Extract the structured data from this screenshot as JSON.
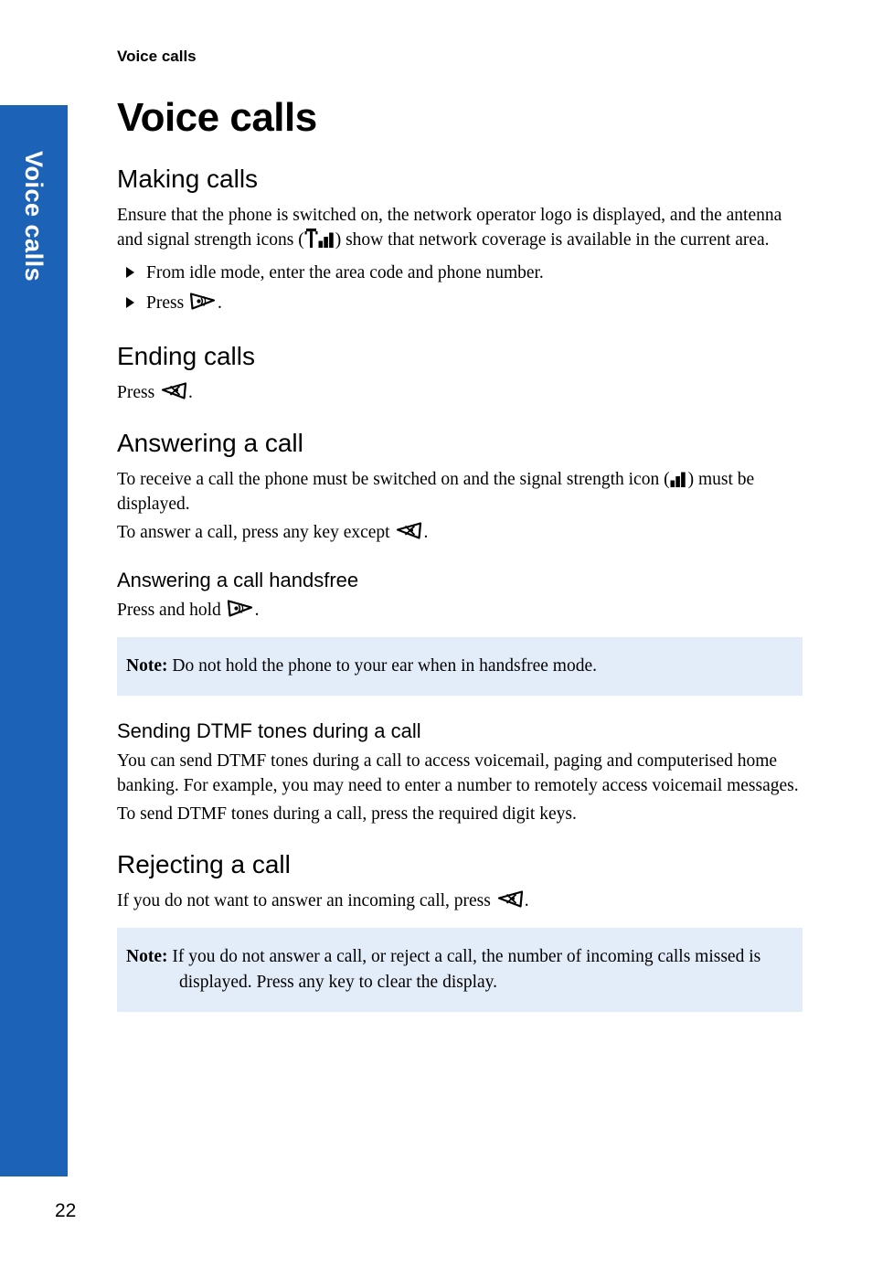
{
  "page": {
    "running_head": "Voice calls",
    "page_number": "22",
    "side_tab_label": "Voice calls",
    "accent_color": "#1c63b8",
    "note_background": "#e3edfa"
  },
  "chapter": {
    "title": "Voice calls"
  },
  "sections": {
    "making_calls": {
      "heading": "Making calls",
      "intro_part1": "Ensure that the phone is switched on, the network operator logo is displayed, and the antenna and signal strength icons (",
      "intro_part2": ") show that network coverage is available in the current area.",
      "steps": [
        {
          "text_before": "From idle mode, enter the area code and phone number.",
          "icon": null,
          "text_after": ""
        },
        {
          "text_before": "Press ",
          "icon": "send-key-icon",
          "text_after": "."
        }
      ]
    },
    "ending_calls": {
      "heading": "Ending calls",
      "text_before": "Press ",
      "icon": "end-key-icon",
      "text_after": "."
    },
    "answering_a_call": {
      "heading": "Answering a call",
      "para1_part1": "To receive a call the phone must be switched on and the signal strength icon (",
      "para1_part2": ") must be displayed.",
      "para2_part1": "To answer a call, press any key except ",
      "para2_part2": ".",
      "handsfree": {
        "heading": "Answering a call handsfree",
        "text_before": "Press and hold ",
        "text_after": "."
      },
      "note": {
        "label": "Note:",
        "text": " Do not hold the phone to your ear when in handsfree mode."
      }
    },
    "sending_dtmf": {
      "heading": "Sending DTMF tones during a call",
      "para1": "You can send DTMF tones during a call to access voicemail, paging and computerised home banking. For example, you may need to enter a number to remotely access voicemail messages.",
      "para2": "To send DTMF tones during a call, press the required digit keys."
    },
    "rejecting_a_call": {
      "heading": "Rejecting a call",
      "para1_part1": "If you do not want to answer an incoming call, press ",
      "para1_part2": ".",
      "note": {
        "label": "Note:",
        "text": " If you do not answer a call, or reject a call, the number of incoming calls missed is displayed. Press any key to clear the display."
      }
    }
  },
  "icons": {
    "antenna_signal": "antenna-signal-strength-icon",
    "signal_strength": "signal-strength-icon",
    "send_key": "send-key-icon",
    "end_key": "end-key-icon",
    "bullet": "bullet-triangle-icon"
  }
}
